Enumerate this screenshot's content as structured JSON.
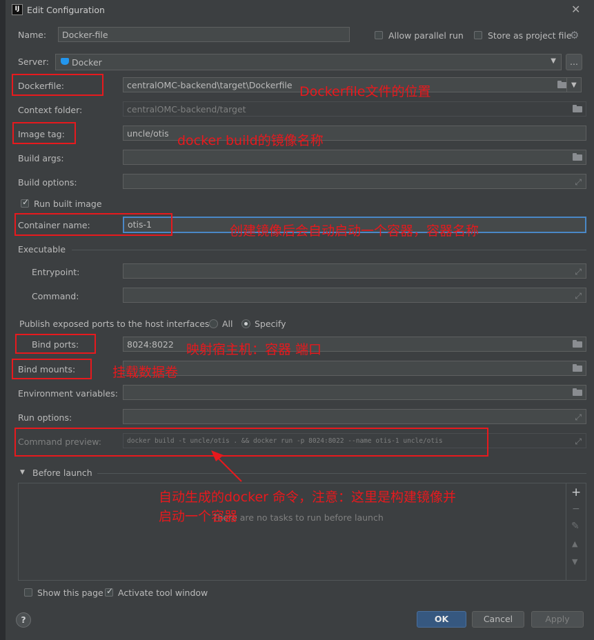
{
  "window": {
    "title": "Edit Configuration",
    "close_icon": "close-icon"
  },
  "name": {
    "label": "Name:",
    "value": "Docker-file",
    "allow_parallel": "Allow parallel run",
    "store_project": "Store as project file"
  },
  "server": {
    "label": "Server:",
    "value": "Docker",
    "more": "..."
  },
  "fields": {
    "dockerfile": {
      "label": "Dockerfile:",
      "value": "centralOMC-backend\\target\\Dockerfile"
    },
    "context": {
      "label": "Context folder:",
      "value": "centralOMC-backend/target"
    },
    "image_tag": {
      "label": "Image tag:",
      "value": "uncle/otis"
    },
    "build_args": {
      "label": "Build args:",
      "value": ""
    },
    "build_options": {
      "label": "Build options:",
      "value": ""
    },
    "run_built": {
      "label": "Run built image"
    },
    "container_name": {
      "label": "Container name:",
      "value": "otis-1"
    },
    "executable": {
      "label": "Executable"
    },
    "entrypoint": {
      "label": "Entrypoint:",
      "value": ""
    },
    "command": {
      "label": "Command:",
      "value": ""
    },
    "publish": {
      "label": "Publish exposed ports to the host interfaces:",
      "all": "All",
      "specify": "Specify"
    },
    "bind_ports": {
      "label": "Bind ports:",
      "value": "8024:8022"
    },
    "bind_mounts": {
      "label": "Bind mounts:",
      "value": ""
    },
    "env": {
      "label": "Environment variables:",
      "value": ""
    },
    "run_options": {
      "label": "Run options:",
      "value": ""
    },
    "preview": {
      "label": "Command preview:",
      "value": "docker build -t uncle/otis . && docker run -p 8024:8022 --name otis-1 uncle/otis"
    }
  },
  "before_launch": {
    "label": "Before launch",
    "empty": "There are no tasks to run before launch"
  },
  "footer": {
    "show_page": "Show this page",
    "activate": "Activate tool window",
    "ok": "OK",
    "cancel": "Cancel",
    "apply": "Apply",
    "help": "?"
  },
  "annotations": {
    "dockerfile": "Dockerfile文件的位置",
    "image_tag": "docker build的镜像名称",
    "container": "创建镜像后会自动启动一个容器，容器名称",
    "ports": "映射宿主机：容器 端口",
    "mounts": "挂载数据卷",
    "preview_line1": "自动生成的docker 命令，注意：这里是构建镜像并",
    "preview_line2": "启动一个容器"
  },
  "colors": {
    "accent": "#4a88c7",
    "annotation": "#e8191d",
    "ok_button": "#365880"
  }
}
